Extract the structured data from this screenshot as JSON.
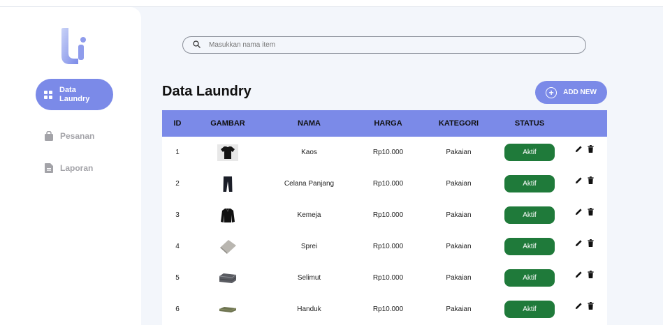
{
  "sidebar": {
    "items": [
      {
        "label": "Data Laundry",
        "icon": "grid-icon",
        "active": true
      },
      {
        "label": "Pesanan",
        "icon": "bag-icon",
        "active": false
      },
      {
        "label": "Laporan",
        "icon": "document-icon",
        "active": false
      }
    ]
  },
  "search": {
    "placeholder": "Masukkan nama item"
  },
  "main": {
    "title": "Data Laundry",
    "add_label": "ADD NEW"
  },
  "table": {
    "headers": [
      "ID",
      "GAMBAR",
      "NAMA",
      "HARGA",
      "KATEGORI",
      "STATUS"
    ],
    "rows": [
      {
        "id": "1",
        "image": "tshirt",
        "nama": "Kaos",
        "harga": "Rp10.000",
        "kategori": "Pakaian",
        "status": "Aktif"
      },
      {
        "id": "2",
        "image": "pants",
        "nama": "Celana Panjang",
        "harga": "Rp10.000",
        "kategori": "Pakaian",
        "status": "Aktif"
      },
      {
        "id": "3",
        "image": "shirt",
        "nama": "Kemeja",
        "harga": "Rp10.000",
        "kategori": "Pakaian",
        "status": "Aktif"
      },
      {
        "id": "4",
        "image": "sheet",
        "nama": "Sprei",
        "harga": "Rp10.000",
        "kategori": "Pakaian",
        "status": "Aktif"
      },
      {
        "id": "5",
        "image": "blanket",
        "nama": "Selimut",
        "harga": "Rp10.000",
        "kategori": "Pakaian",
        "status": "Aktif"
      },
      {
        "id": "6",
        "image": "towel",
        "nama": "Handuk",
        "harga": "Rp10.000",
        "kategori": "Pakaian",
        "status": "Aktif"
      }
    ]
  },
  "colors": {
    "accent": "#7b8ae8",
    "status_active": "#1f7a3a",
    "background": "#f3f6fb"
  }
}
